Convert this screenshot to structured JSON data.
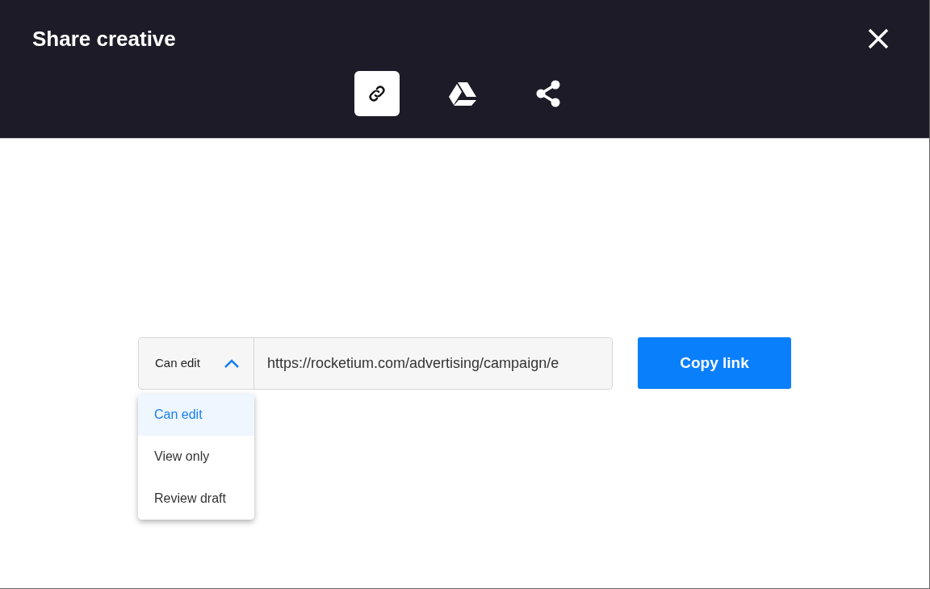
{
  "dialog": {
    "title": "Share creative"
  },
  "tabs": [
    {
      "kind": "link",
      "selected": true
    },
    {
      "kind": "drive",
      "selected": false
    },
    {
      "kind": "share",
      "selected": false
    }
  ],
  "permission": {
    "value": "Can edit",
    "expanded": true,
    "options": [
      {
        "label": "Can edit",
        "selected": true
      },
      {
        "label": "View only",
        "selected": false
      },
      {
        "label": "Review draft",
        "selected": false
      }
    ]
  },
  "link_field": {
    "value": "https://rocketium.com/advertising/campaign/e"
  },
  "copy_button": {
    "label": "Copy link"
  }
}
